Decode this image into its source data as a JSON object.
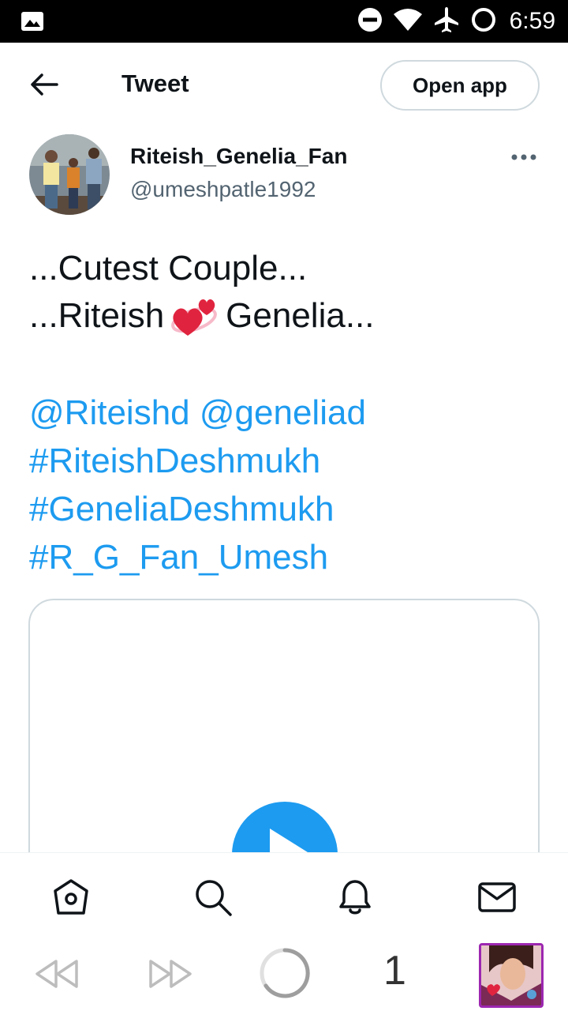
{
  "status_bar": {
    "time": "6:59",
    "icons": [
      "gallery-icon",
      "do-not-disturb-icon",
      "wifi-icon",
      "airplane-mode-icon",
      "sync-ring-icon"
    ]
  },
  "header": {
    "back_icon": "arrow-left-icon",
    "title": "Tweet",
    "open_app_label": "Open app"
  },
  "tweet": {
    "author": {
      "display_name": "Riteish_Genelia_Fan",
      "username": "@umeshpatle1992"
    },
    "more_icon": "ellipsis-icon",
    "text_line1": "...Cutest Couple...",
    "text_line2_before": "...Riteish",
    "text_line2_emoji": "revolving-hearts-emoji",
    "text_line2_after": "Genelia...",
    "mention1": "@Riteishd",
    "mention2": "@geneliad",
    "hashtag1": "#RiteishDeshmukh",
    "hashtag2": "#GeneliaDeshmukh",
    "hashtag3": "#R_G_Fan_Umesh",
    "media": {
      "play_icon": "play-icon"
    }
  },
  "bottom_nav": {
    "items": [
      "home-icon",
      "search-icon",
      "notifications-bell-icon",
      "messages-mail-icon"
    ]
  },
  "media_bar": {
    "rewind_icon": "rewind-icon",
    "fast_forward_icon": "fast-forward-icon",
    "loading_icon": "loading-spinner-icon",
    "count": "1"
  },
  "colors": {
    "accent": "#1d9bf0",
    "text_primary": "#0f1419",
    "text_secondary": "#536471",
    "border": "#cfd9de",
    "thumb_border": "#9c27b0"
  }
}
